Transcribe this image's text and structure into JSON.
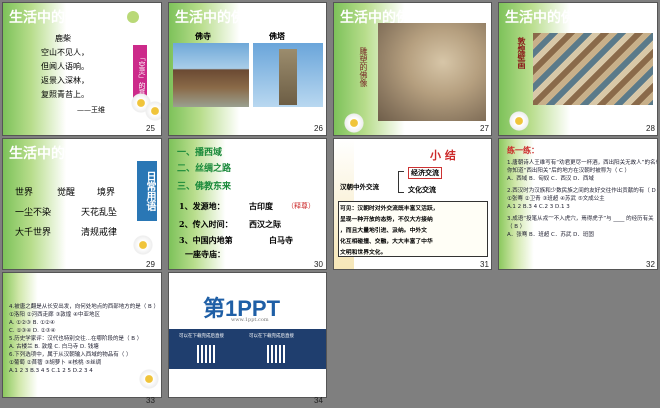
{
  "window": {
    "title": "生活中的佛教"
  },
  "slides": [
    {
      "num": "25",
      "title": "生活中的佛教",
      "poem_title": "鹿柴",
      "lines": [
        "空山不见人，",
        "但闻人语响。",
        "返景入深林，",
        "复照青苔上。"
      ],
      "author": "——王维",
      "side_label": "「空灵」的意"
    },
    {
      "num": "26",
      "title": "生活中的佛教",
      "label_left": "佛寺",
      "label_right": "佛塔"
    },
    {
      "num": "27",
      "title": "生活中的佛教",
      "caption": "雕塑的佛像"
    },
    {
      "num": "28",
      "title": "生活中的佛教",
      "caption": "敦煌壁画"
    },
    {
      "num": "29",
      "title": "生活中的佛教",
      "words": [
        "世界",
        "觉醒",
        "境界",
        "一尘不染",
        "天花乱坠",
        "大千世界",
        "清规戒律"
      ],
      "side": "日常用语"
    },
    {
      "num": "30",
      "items": [
        "一、播西域",
        "二、丝绸之路",
        "三、佛教东来"
      ],
      "points": [
        "1、发源地：",
        "古印度",
        "（释尊）",
        "2、传入时间：",
        "西汉之际",
        "3、中国内地第",
        "白马寺",
        "一座寺庙："
      ]
    },
    {
      "num": "31",
      "title": "小  结",
      "center": "汉朝中外交流",
      "branches": [
        "经济交流",
        "文化交流"
      ],
      "summary": [
        "可见：汉朝时对外交流既丰富又活跃，",
        "呈现一种开放的态势，不仅大方接纳",
        "，而且大量地引进、汲纳。中外文",
        "化互相碰撞、交融，大大丰富了中华",
        "文明和世界文化。"
      ]
    },
    {
      "num": "32",
      "title": "练一练：",
      "questions": [
        "1.唐朝诗人王维写有“劝君更尽一杯酒，西出阳关无故人”的名句，",
        "   你知道“西出阳关”后的地方在汉朝时被称为（ C ）",
        "   A．西域       B．匈奴      C．西汉      D．西域",
        "2.西汉时为汉族和少数民族之间的友好交往作出贡献的有（ D ）",
        "   ①张骞  ②卫青    ③班超   ④苏武   ⑤文成公主",
        "   A.1 2          B.3 4           C.2 3              D.1 3",
        "3.成语“投笔从戎”“不入虎穴，焉得虎子”与 ____ 的经历有关",
        "   （ B ）",
        "   A．张骞       B．班超      C．苏武      D．班固"
      ]
    },
    {
      "num": "33",
      "questions": [
        "4.被唐之翻是从长安出发，向何处地点的西部地方的是（ B ）",
        "   ①洛阳  ②河西走廊  ③敦煌  ④中亚地区",
        "   A. ①②③       B. ①②④",
        "   C. ①③④       D. ②③④",
        "5.历史学家评：汉代也特别交往...在哪阶段的是（ B ）",
        "   A. 古楼兰      B. 敦煌       C. 白马寺      D. 钱塘",
        "6.下列选项中，属于从汉朝输入西域的物品有（ ）",
        "   ①葡萄  ②苜蓿  ③胡萝卜  ④核桃  ⑤丝绸",
        "   A.1 2 3      B.3 4 5      C.1 2 5      D.2 3 4"
      ]
    },
    {
      "num": "34",
      "logo": "第1PPT",
      "logo_sub": "www.1ppt.com",
      "info": [
        "可以在下载完成后直接",
        "可以在下载完成后直接"
      ]
    }
  ]
}
